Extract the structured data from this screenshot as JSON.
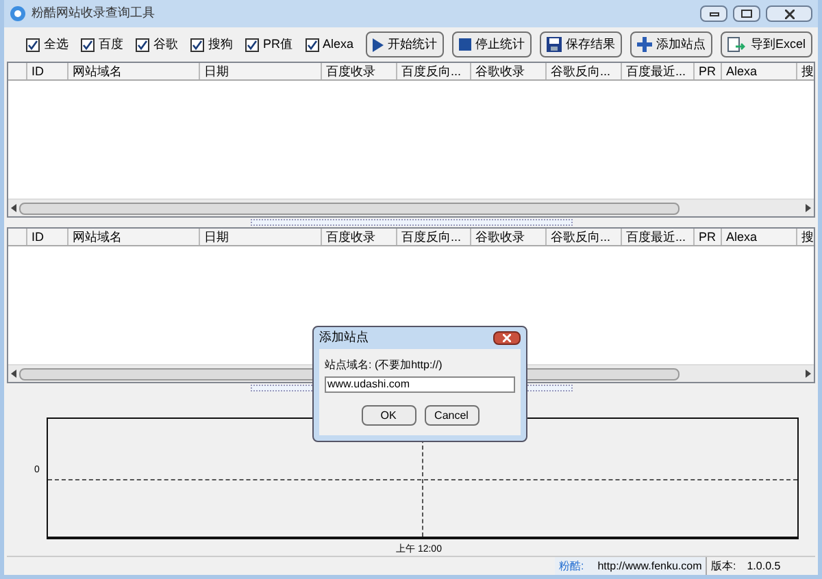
{
  "window": {
    "title": "粉酷网站收录查询工具"
  },
  "options": [
    {
      "label": "全选",
      "checked": true
    },
    {
      "label": "百度",
      "checked": true
    },
    {
      "label": "谷歌",
      "checked": true
    },
    {
      "label": "搜狗",
      "checked": true
    },
    {
      "label": "PR值",
      "checked": true
    },
    {
      "label": "Alexa",
      "checked": true
    }
  ],
  "buttons": [
    {
      "kind": "play",
      "label": "开始统计"
    },
    {
      "kind": "stop",
      "label": "停止统计"
    },
    {
      "kind": "save",
      "label": "保存结果"
    },
    {
      "kind": "add",
      "label": "添加站点"
    },
    {
      "kind": "export",
      "label": "导到Excel"
    }
  ],
  "tables": [
    {
      "columns": [
        "ID",
        "网站域名",
        "日期",
        "百度收录",
        "百度反向...",
        "谷歌收录",
        "谷歌反向...",
        "百度最近...",
        "PR",
        "Alexa",
        "搜"
      ]
    },
    {
      "columns": [
        "ID",
        "网站域名",
        "日期",
        "百度收录",
        "百度反向...",
        "谷歌收录",
        "谷歌反向...",
        "百度最近...",
        "PR",
        "Alexa",
        "搜"
      ]
    }
  ],
  "chart": {
    "y_tick": "0",
    "x_tick": "上午 12:00"
  },
  "status_bar": {
    "site_label": "粉酷:",
    "site": "http://www.fenku.com",
    "version_label": "版本:",
    "version": "1.0.0.5"
  },
  "dialog": {
    "title": "添加站点",
    "label": "站点域名: (不要加http://)",
    "value": "www.udashi.com",
    "buttons": [
      "OK",
      "Cancel"
    ]
  }
}
